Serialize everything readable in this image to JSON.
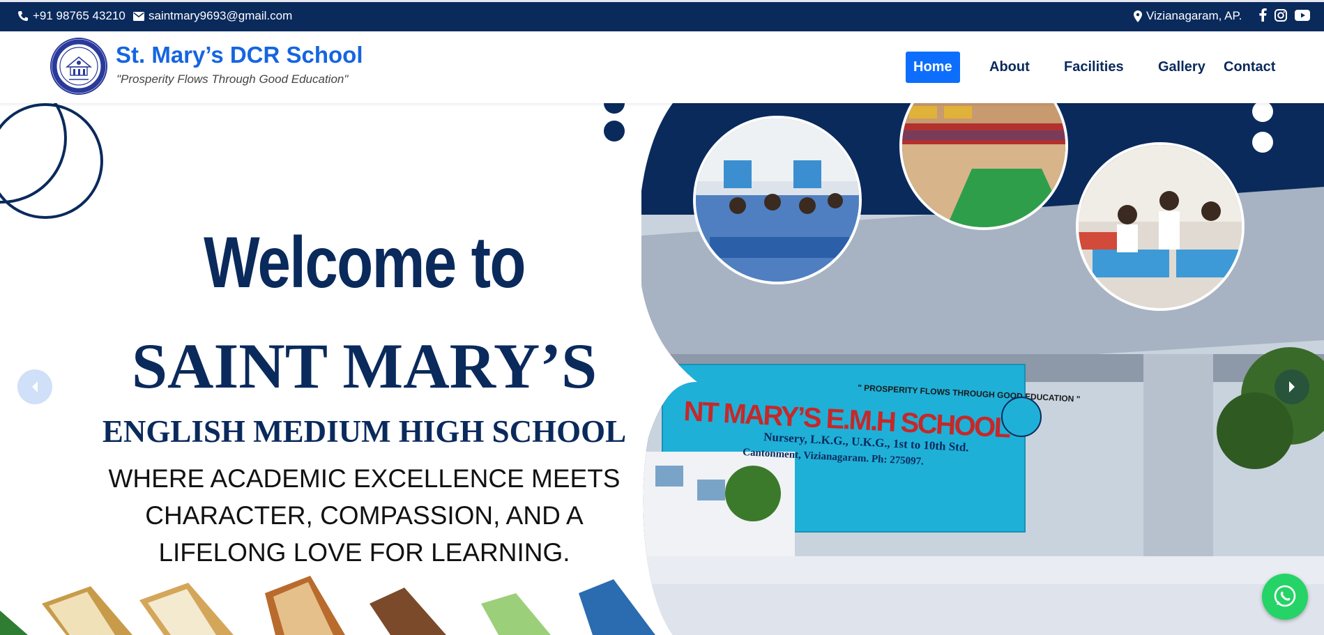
{
  "topbar": {
    "phone": "+91 98765 43210",
    "email": "saintmary9693@gmail.com",
    "location": "Vizianagaram, AP.",
    "icons": [
      "phone-icon",
      "mail-icon",
      "map-marker-icon",
      "facebook-icon",
      "instagram-icon",
      "youtube-icon"
    ]
  },
  "header": {
    "brand_title": "St. Mary’s DCR School",
    "tagline": "\"Prosperity Flows Through Good Education\"",
    "logo_icon": "school-crest-logo"
  },
  "nav": {
    "home": "Home",
    "about": "About",
    "facilities": "Facilities",
    "gallery": "Gallery",
    "contact": "Contact",
    "active": "Home"
  },
  "hero": {
    "welcome": "Welcome to",
    "school_name": "SAINT MARY’S",
    "school_type": "ENGLISH MEDIUM HIGH SCHOOL",
    "tagline_line1": "WHERE ACADEMIC EXCELLENCE MEETS",
    "tagline_line2": "CHARACTER, COMPASSION, AND A",
    "tagline_line3": "LIFELONG LOVE FOR LEARNING.",
    "banner_text": "NT MARY’S E.M.H SCHOOL",
    "banner_motto": "\" PROSPERITY FLOWS THROUGH GOOD EDUCATION \"",
    "banner_line1": "Nursery, L.K.G., U.K.G., 1st to 10th Std.",
    "banner_line2": "Cantonment, Vizianagaram. Ph: 275097."
  },
  "colors": {
    "navy": "#0a2a5c",
    "brand_blue": "#1565e0",
    "nav_active": "#0d6efd",
    "whatsapp": "#25d366"
  },
  "controls": {
    "prev_icon": "chevron-left-icon",
    "next_icon": "chevron-right-icon",
    "whatsapp_icon": "whatsapp-icon"
  }
}
